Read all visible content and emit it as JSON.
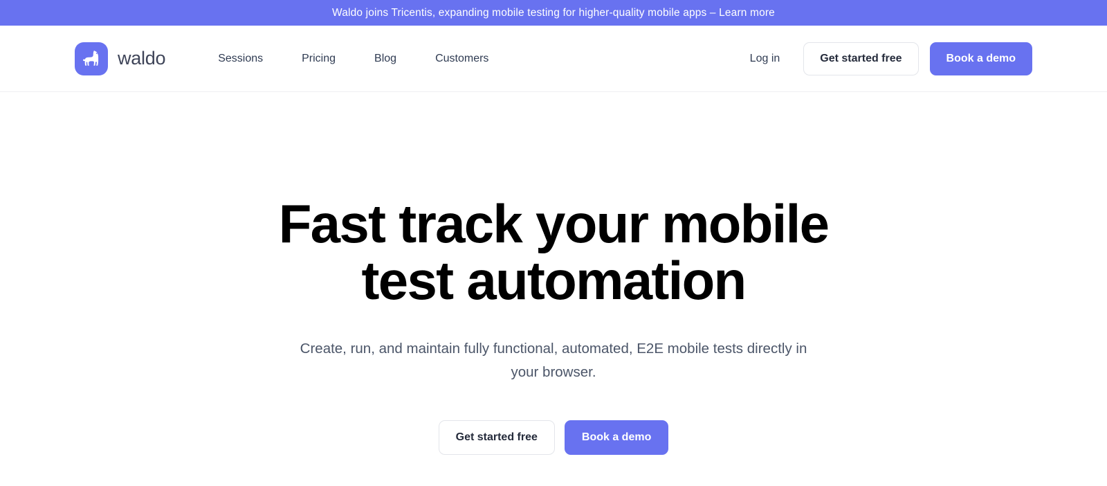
{
  "announcement": {
    "text": "Waldo joins Tricentis, expanding mobile testing for higher-quality mobile apps – Learn more",
    "background_color": "#6872f0",
    "text_color": "#ffffff"
  },
  "header": {
    "brand": {
      "wordmark": "waldo",
      "icon": "llama-icon",
      "mark_color": "#6872f0"
    },
    "nav": [
      {
        "label": "Sessions"
      },
      {
        "label": "Pricing"
      },
      {
        "label": "Blog"
      },
      {
        "label": "Customers"
      }
    ],
    "actions": {
      "login_label": "Log in",
      "get_started_label": "Get started free",
      "book_demo_label": "Book a demo"
    }
  },
  "hero": {
    "title": "Fast track your mobile test automation",
    "subtitle": "Create, run, and maintain fully functional, automated, E2E mobile tests directly in your browser.",
    "primary_cta": "Book a demo",
    "secondary_cta": "Get started free"
  },
  "theme": {
    "accent": "#6872f0",
    "text_dark": "#000000",
    "text_muted": "#4b5568",
    "nav_text": "#2f3b52",
    "border": "#e3e5ea"
  }
}
